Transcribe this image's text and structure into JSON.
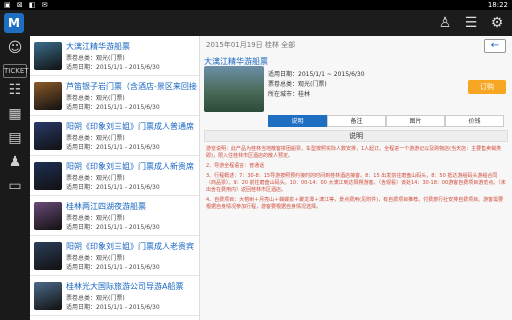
{
  "status": {
    "left": "▣ ⊠ ◧ ✉",
    "time": "18:22"
  },
  "appbar": {
    "logo_text": "M"
  },
  "sidebar": [
    "user-icon",
    "ticket-icon",
    "list-icon",
    "grid-icon",
    "card-icon",
    "person-icon",
    "atm-icon"
  ],
  "list_items": [
    {
      "title": "大漓江精华游船票",
      "sub1": "票卷总类：观光(门票)",
      "sub2": "适用日期：2015/1/1 - 2015/6/30",
      "color": "#3a6e8c"
    },
    {
      "title": "芦笛银子岩门票（含酒店-景区来回接",
      "sub1": "票卷总类：观光(门票)",
      "sub2": "适用日期：2015/1/1 - 2015/6/30",
      "color": "#8b5a2b"
    },
    {
      "title": "阳朔《印象刘三姐》门票成人普通席",
      "sub1": "票卷总类：观光(门票)",
      "sub2": "适用日期：2015/1/1 - 2015/6/30",
      "color": "#2a3a6a"
    },
    {
      "title": "阳朔《印象刘三姐》门票成人新贵席",
      "sub1": "票卷总类：观光(门票)",
      "sub2": "适用日期：2015/1/1 - 2015/6/30",
      "color": "#1f2f55"
    },
    {
      "title": "桂林两江四湖夜游船票",
      "sub1": "票卷总类：观光(门票)",
      "sub2": "适用日期：2015/1/1 - 2015/6/30",
      "color": "#6a4a7a"
    },
    {
      "title": "阳朔《印象刘三姐》门票成人老贵宾",
      "sub1": "票卷总类：观光(门票)",
      "sub2": "适用日期：2015/1/1 - 2015/6/30",
      "color": "#2c3e5a"
    },
    {
      "title": "桂林光大国际旅游公司导游A船票",
      "sub1": "票卷总类：观光(门票)",
      "sub2": "适用日期：2015/1/1 - 2015/6/30",
      "color": "#4a6a8a"
    }
  ],
  "detail": {
    "header": "2015年01月19日  桂林  全部",
    "back": "←",
    "title": "大漓江精华游船票",
    "dates": "适用日期：2015/1/1 ~ 2015/6/30",
    "type": "票卷总类：观光(门票)",
    "city": "所在城市：桂林",
    "order": "订购",
    "tabs": [
      "说明",
      "备注",
      "图片",
      "价钱"
    ],
    "section": "说明",
    "desc": [
      "游览说明：此产品为桂林当地散客拼团船票，车型按照实际人数安排，1人起订。全程进一个游游记以及购物店(当天店：主要售卖锡类即)，限入住桂林市区酒店的散人预定。",
      "2、导游全程语言：普通话",
      "3、行程概述：7：30-8：15导游按照预约接时的时间到桂林酒店接客。8：15 出发前往磨盘山码头，8：50 抵达游船码头游船合同（商品票）。9：20 前往磨盘山码头。10：00-14：00 大漓江到达阳朔游客。（含观看）该处14：30-18：00游客自费项目游览点。（未出含在费用内）返回桂林市区酒店。",
      "4、自费项目：大榕树＋月亮山＋蝴蝶泉＋聚龙潭＋漓江等，景点费用(见附件)，有自费项目推荐。付费旅行社安排自费项目。游客需要根据自身情况参加行程，游客要根据自身情况选择。"
    ]
  }
}
